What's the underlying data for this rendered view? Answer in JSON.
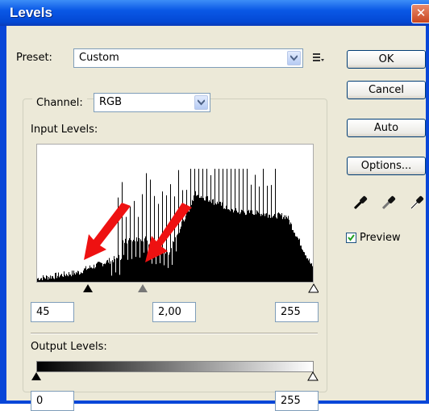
{
  "window": {
    "title": "Levels"
  },
  "preset": {
    "label": "Preset:",
    "value": "Custom"
  },
  "channel": {
    "label": "Channel:",
    "value": "RGB"
  },
  "input_levels": {
    "label": "Input Levels:",
    "black": "45",
    "gamma": "2,00",
    "white": "255"
  },
  "output_levels": {
    "label": "Output Levels:",
    "black": "0",
    "white": "255"
  },
  "buttons": {
    "ok": "OK",
    "cancel": "Cancel",
    "auto": "Auto",
    "options": "Options..."
  },
  "preview": {
    "label": "Preview",
    "checked": true
  },
  "colors": {
    "titlebar": "#0846d8",
    "dialog_bg": "#ece9d8",
    "arrow": "#ee1111",
    "check": "#21a121"
  }
}
